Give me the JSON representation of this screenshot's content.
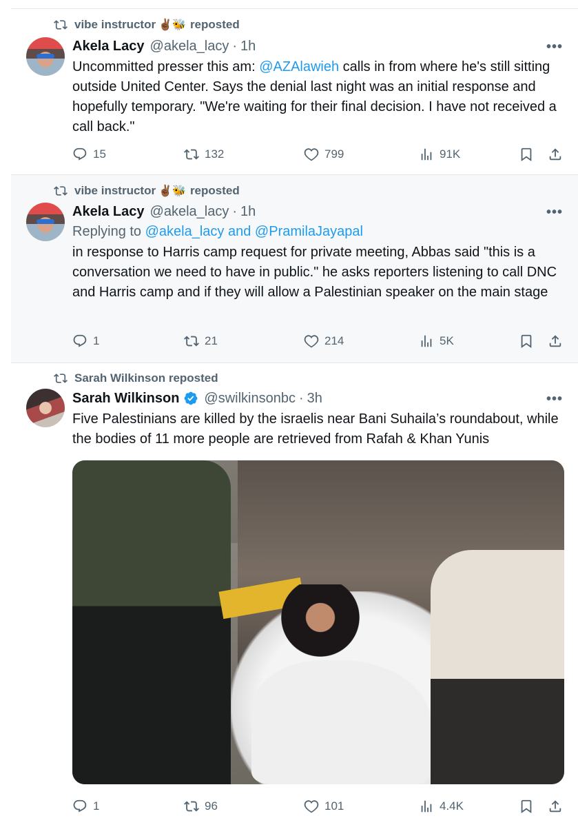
{
  "tweets": [
    {
      "repost_by": "vibe instructor",
      "repost_emoji": "✌🏾🐝",
      "repost_suffix": "reposted",
      "name": "Akela Lacy",
      "handle": "@akela_lacy",
      "time": "1h",
      "more": "•••",
      "text_parts": [
        "Uncommitted presser this am: ",
        "@AZAlawieh",
        " calls in from where he's still sitting outside United Center. Says the denial last night was an initial response and hopefully temporary. \"We're waiting for their final decision. I have not received a call back.\""
      ],
      "stats": {
        "replies": "15",
        "reposts": "132",
        "likes": "799",
        "views": "91K"
      }
    },
    {
      "repost_by": "vibe instructor",
      "repost_emoji": "✌🏾🐝",
      "repost_suffix": "reposted",
      "name": "Akela Lacy",
      "handle": "@akela_lacy",
      "time": "1h",
      "more": "•••",
      "reply_prefix": "Replying to ",
      "reply_targets": "@akela_lacy and @PramilaJayapal",
      "text": "in response to Harris camp request for private meeting, Abbas said \"this is a conversation we need to have in public.\" he asks reporters listening to call DNC and Harris camp and if they will allow a Palestinian speaker on the main stage",
      "stats": {
        "replies": "1",
        "reposts": "21",
        "likes": "214",
        "views": "5K"
      }
    },
    {
      "repost_by": "Sarah Wilkinson reposted",
      "name": "Sarah Wilkinson",
      "handle": "@swilkinsonbc",
      "time": "3h",
      "more": "•••",
      "text": "Five Palestinians are killed by the israelis near Bani Suhaila’s roundabout, while the bodies of 11 more people are retrieved from Rafah & Khan Yunis",
      "stats": {
        "replies": "1",
        "reposts": "96",
        "likes": "101",
        "views": "4.4K"
      }
    }
  ],
  "colors": {
    "text": "#0f1419",
    "muted": "#536471",
    "link": "#1d9bf0",
    "verified": "#1d9bf0",
    "gray_bg": "#f7f8f9"
  }
}
